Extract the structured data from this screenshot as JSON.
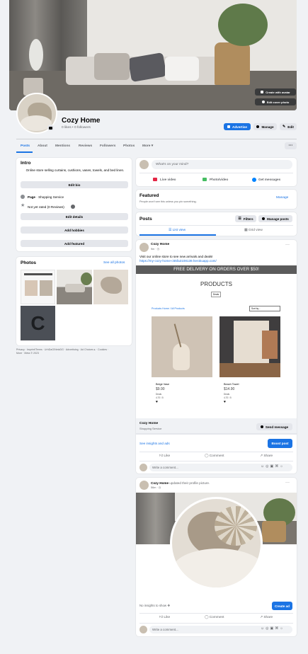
{
  "cover": {
    "avatar_btn": "Create with avatar",
    "edit_cover": "Edit cover photo"
  },
  "profile": {
    "name": "Cozy Home",
    "stats": "0 likes • 0 followers",
    "advertise": "Advertise",
    "manage": "Manage",
    "edit": "Edit"
  },
  "tabs": [
    {
      "label": "Posts"
    },
    {
      "label": "About"
    },
    {
      "label": "Mentions"
    },
    {
      "label": "Reviews"
    },
    {
      "label": "Followers"
    },
    {
      "label": "Photos"
    },
    {
      "label": "More ▾"
    }
  ],
  "intro": {
    "title": "Intro",
    "bio": "Online store selling curtains, cushions, vases, towels, and bed linen.",
    "edit_bio": "Edit bio",
    "page_label": "Page",
    "page_type": " · Shopping Service",
    "rating": "Not yet rated (0 Reviews)",
    "edit_details": "Edit details",
    "add_hobbies": "Add hobbies",
    "add_featured": "Add featured"
  },
  "photos": {
    "title": "Photos",
    "see_all": "See all photos",
    "letter": "C"
  },
  "footer": {
    "line1": "Privacy · Imprint/Terms · UrhDaG/NetzDG · Advertising · Ad Choices ▸ · Cookies ·",
    "line2": "More · Meta © 2023"
  },
  "composer": {
    "placeholder": "What's on your mind?",
    "live": "Live video",
    "photo": "Photo/video",
    "messages": "Get messages"
  },
  "featured": {
    "title": "Featured",
    "sub": "People won't see this unless you pin something.",
    "manage": "Manage"
  },
  "posts": {
    "title": "Posts",
    "filters": "Filters",
    "manage_posts": "Manage posts",
    "list_view": "List view",
    "grid_view": "Grid view"
  },
  "post1": {
    "author": "Cozy Home",
    "time": "9m · ◷",
    "text": "Visit our online store to see new arrivals and deals!",
    "link": "https://my-cozy-home-c55fa3108139.herokuapp.com/",
    "banner": "FREE DELIVERY ON ORDERS OVER $50!",
    "heading": "PRODUCTS",
    "filter": "Deals",
    "crumb": "Products Home / All Products",
    "sort": "Sort by...",
    "p1_name": "Beige Vase",
    "p1_price": "$9.90",
    "p1_cat": "Deals",
    "p1_rating": "4.70 / 5",
    "p2_name": "Beach Towel",
    "p2_price": "$14.90",
    "p2_cat": "Deals",
    "p2_rating": "4.70 / 5",
    "page_name": "Cozy Home",
    "page_type": "Shopping Service",
    "send": "Send message",
    "insights": "See insights and ads",
    "boost": "Boost post",
    "like": "Like",
    "comment": "Comment",
    "share": "Share",
    "write": "Write a comment..."
  },
  "post2": {
    "author": "Cozy Home",
    "action": " updated their profile picture.",
    "time": "56m · ◷",
    "insights": "No insights to show ❖",
    "create_ad": "Create ad",
    "like": "Like",
    "comment": "Comment",
    "share": "Share",
    "write": "Write a comment..."
  }
}
